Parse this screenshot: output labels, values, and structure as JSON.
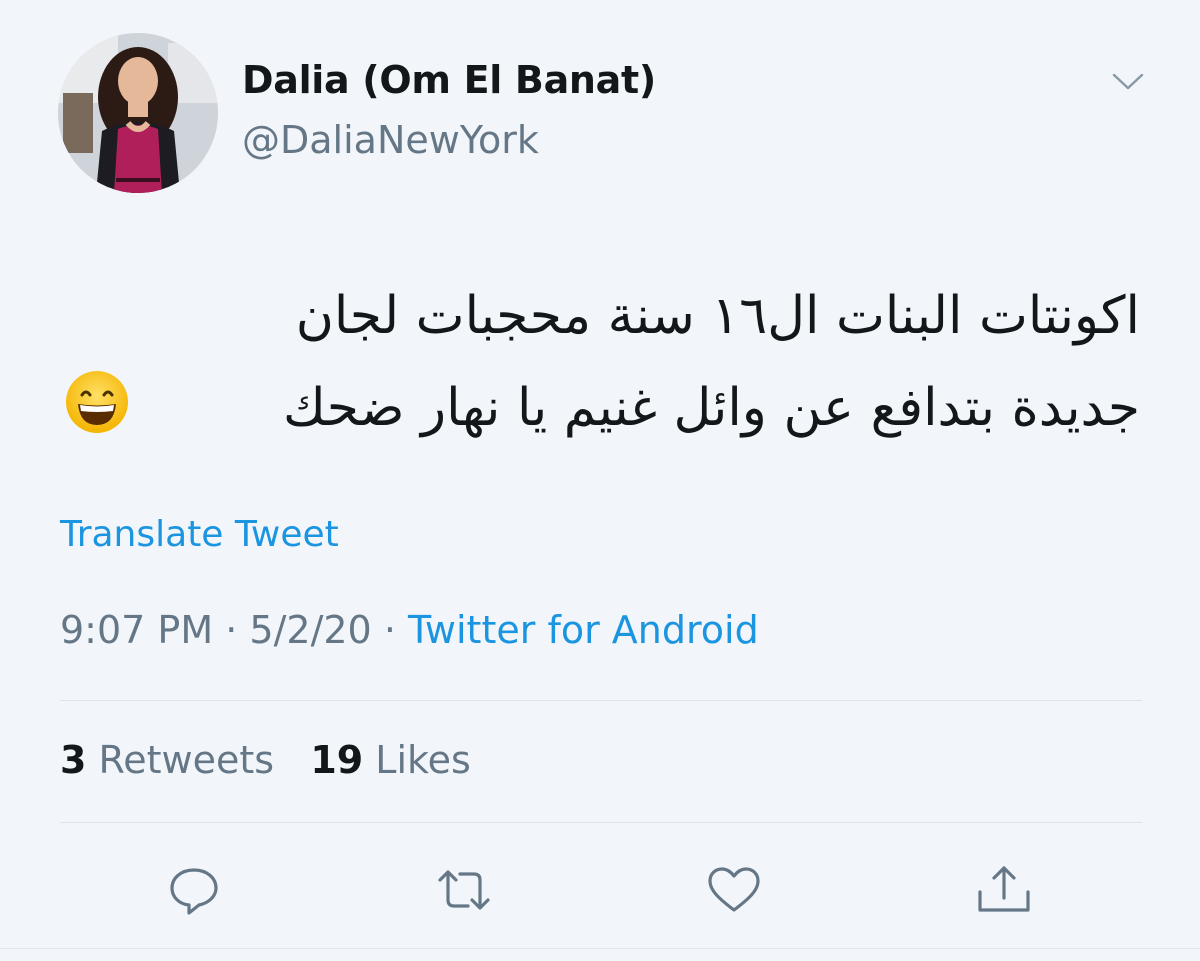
{
  "user": {
    "display_name": "Dalia (Om El Banat)",
    "handle": "@DaliaNewYork"
  },
  "tweet": {
    "text_line1": "اكونتات البنات ال١٦ سنة محجبات لجان",
    "text_line2": "جديدة بتدافع عن وائل غنيم يا نهار ضحك",
    "translate_label": "Translate Tweet"
  },
  "meta": {
    "time": "9:07 PM",
    "date": "5/2/20",
    "separator": "·",
    "source": "Twitter for Android"
  },
  "stats": {
    "retweets_count": "3",
    "retweets_label": "Retweets",
    "likes_count": "19",
    "likes_label": "Likes"
  },
  "icons": {
    "reply": "speech-bubble-icon",
    "retweet": "retweet-arrows-icon",
    "like": "heart-icon",
    "share": "share-upload-icon",
    "caret": "chevron-down-icon",
    "emoji": "grinning-face-emoji"
  },
  "colors": {
    "link": "#1b95e0",
    "secondary": "#657786",
    "primary": "#14171a",
    "icon": "#657786",
    "background": "#f2f6fb"
  }
}
